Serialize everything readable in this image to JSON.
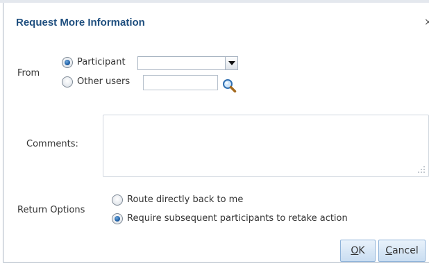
{
  "dialog": {
    "title": "Request More Information",
    "close_glyph": "×"
  },
  "from": {
    "label": "From",
    "participant_label": "Participant",
    "participant_selected": true,
    "participant_value": "",
    "other_users_label": "Other users",
    "other_users_selected": false,
    "other_users_value": ""
  },
  "comments": {
    "label": "Comments:",
    "value": ""
  },
  "return_options": {
    "label": "Return Options",
    "options": [
      {
        "label": "Route directly back to me",
        "selected": false
      },
      {
        "label": "Require subsequent participants to retake action",
        "selected": true
      }
    ]
  },
  "buttons": {
    "ok": {
      "access_key": "O",
      "rest": "K"
    },
    "cancel": {
      "access_key": "C",
      "rest": "ancel"
    }
  },
  "colors": {
    "title": "#1f4f7f",
    "button_border": "#8fb3d9",
    "button_fill": "#c9ddf1",
    "radio_dot": "#1d5fa6"
  },
  "icons": [
    "close-icon",
    "chevron-down-icon",
    "search-icon",
    "resize-grip-icon"
  ]
}
